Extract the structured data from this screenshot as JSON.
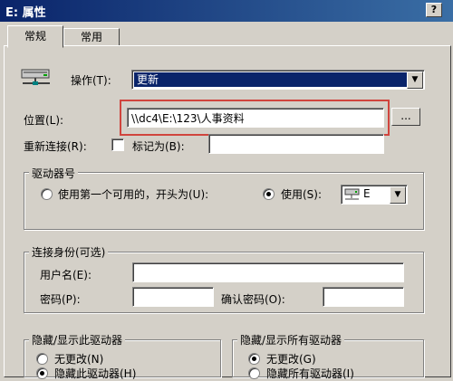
{
  "window": {
    "title": "E: 属性",
    "help_glyph": "?"
  },
  "tabs": [
    {
      "label": "常规"
    },
    {
      "label": "常用"
    }
  ],
  "action": {
    "label": "操作(T):",
    "selected": "更新"
  },
  "location": {
    "label": "位置(L):",
    "value": "\\\\dc4\\E:\\123\\人事资料",
    "browse_label": "..."
  },
  "reconnect": {
    "label": "重新连接(R):",
    "checkbox_label": "标记为(B):",
    "checked": false,
    "label_field_value": ""
  },
  "drive_group": {
    "legend": "驱动器号",
    "option_first_available": "使用第一个可用的，开头为(U):",
    "option_use": "使用(S):",
    "drive_letter": "E"
  },
  "connect_as": {
    "legend": "连接身份(可选)",
    "username_label": "用户名(E):",
    "password_label": "密码(P):",
    "confirm_label": "确认密码(O):"
  },
  "hide_this": {
    "legend": "隐藏/显示此驱动器",
    "option_no_change": "无更改(N)",
    "option_hide": "隐藏此驱动器(H)"
  },
  "hide_all": {
    "legend": "隐藏/显示所有驱动器",
    "option_no_change": "无更改(G)",
    "option_hide": "隐藏所有驱动器(I)"
  }
}
